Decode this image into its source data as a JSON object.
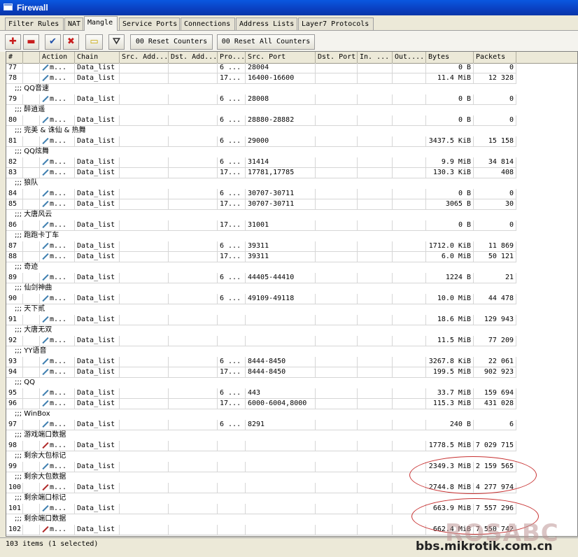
{
  "window": {
    "title": "Firewall"
  },
  "tabs": [
    "Filter Rules",
    "NAT",
    "Mangle",
    "Service Ports",
    "Connections",
    "Address Lists",
    "Layer7 Protocols"
  ],
  "active_tab": "Mangle",
  "toolbar": {
    "reset_counters": "00 Reset Counters",
    "reset_all_counters": "00 Reset All Counters"
  },
  "columns": [
    "#",
    "",
    "Action",
    "Chain",
    "Src. Add...",
    "Dst. Add...",
    "Pro...",
    "Src. Port",
    "Dst. Port",
    "In. ...",
    "Out....",
    "Bytes",
    "Packets"
  ],
  "rows": [
    {
      "type": "rule",
      "num": "77",
      "icon": "blue",
      "action": "m...",
      "chain": "Data_list",
      "proto": "6 ...",
      "src_port": "28004",
      "bytes": "0 B",
      "packets": "0"
    },
    {
      "type": "rule",
      "num": "78",
      "icon": "blue",
      "action": "m...",
      "chain": "Data_list",
      "proto": "17...",
      "src_port": "16400-16600",
      "bytes": "11.4 MiB",
      "packets": "12 328"
    },
    {
      "type": "comment",
      "text": ";;; QQ音速"
    },
    {
      "type": "rule",
      "num": "79",
      "icon": "blue",
      "action": "m...",
      "chain": "Data_list",
      "proto": "6 ...",
      "src_port": "28008",
      "bytes": "0 B",
      "packets": "0"
    },
    {
      "type": "comment",
      "text": ";;; 醉逍遥"
    },
    {
      "type": "rule",
      "num": "80",
      "icon": "blue",
      "action": "m...",
      "chain": "Data_list",
      "proto": "6 ...",
      "src_port": "28880-28882",
      "bytes": "0 B",
      "packets": "0"
    },
    {
      "type": "comment",
      "text": ";;; 完美 & 诛仙 & 热舞"
    },
    {
      "type": "rule",
      "num": "81",
      "icon": "blue",
      "action": "m...",
      "chain": "Data_list",
      "proto": "6 ...",
      "src_port": "29000",
      "bytes": "3437.5 KiB",
      "packets": "15 158"
    },
    {
      "type": "comment",
      "text": ";;; QQ炫舞"
    },
    {
      "type": "rule",
      "num": "82",
      "icon": "blue",
      "action": "m...",
      "chain": "Data_list",
      "proto": "6 ...",
      "src_port": "31414",
      "bytes": "9.9 MiB",
      "packets": "34 814"
    },
    {
      "type": "rule",
      "num": "83",
      "icon": "blue",
      "action": "m...",
      "chain": "Data_list",
      "proto": "17...",
      "src_port": "17781,17785",
      "bytes": "130.3 KiB",
      "packets": "408"
    },
    {
      "type": "comment",
      "text": ";;; 狼队"
    },
    {
      "type": "rule",
      "num": "84",
      "icon": "blue",
      "action": "m...",
      "chain": "Data_list",
      "proto": "6 ...",
      "src_port": "30707-30711",
      "bytes": "0 B",
      "packets": "0"
    },
    {
      "type": "rule",
      "num": "85",
      "icon": "blue",
      "action": "m...",
      "chain": "Data_list",
      "proto": "17...",
      "src_port": "30707-30711",
      "bytes": "3065 B",
      "packets": "30"
    },
    {
      "type": "comment",
      "text": ";;; 大唐风云"
    },
    {
      "type": "rule",
      "num": "86",
      "icon": "blue",
      "action": "m...",
      "chain": "Data_list",
      "proto": "17...",
      "src_port": "31001",
      "bytes": "0 B",
      "packets": "0"
    },
    {
      "type": "comment",
      "text": ";;; 跑跑卡丁车"
    },
    {
      "type": "rule",
      "num": "87",
      "icon": "blue",
      "action": "m...",
      "chain": "Data_list",
      "proto": "6 ...",
      "src_port": "39311",
      "bytes": "1712.0 KiB",
      "packets": "11 869"
    },
    {
      "type": "rule",
      "num": "88",
      "icon": "blue",
      "action": "m...",
      "chain": "Data_list",
      "proto": "17...",
      "src_port": "39311",
      "bytes": "6.0 MiB",
      "packets": "50 121"
    },
    {
      "type": "comment",
      "text": ";;; 奇迹"
    },
    {
      "type": "rule",
      "num": "89",
      "icon": "blue",
      "action": "m...",
      "chain": "Data_list",
      "proto": "6 ...",
      "src_port": "44405-44410",
      "bytes": "1224 B",
      "packets": "21"
    },
    {
      "type": "comment",
      "text": ";;; 仙剑神曲"
    },
    {
      "type": "rule",
      "num": "90",
      "icon": "blue",
      "action": "m...",
      "chain": "Data_list",
      "proto": "6 ...",
      "src_port": "49109-49118",
      "bytes": "10.0 MiB",
      "packets": "44 478"
    },
    {
      "type": "comment",
      "text": ";;; 天下贰"
    },
    {
      "type": "rule",
      "num": "91",
      "icon": "blue",
      "action": "m...",
      "chain": "Data_list",
      "proto": "",
      "src_port": "",
      "bytes": "18.6 MiB",
      "packets": "129 943"
    },
    {
      "type": "comment",
      "text": ";;; 大唐无双"
    },
    {
      "type": "rule",
      "num": "92",
      "icon": "blue",
      "action": "m...",
      "chain": "Data_list",
      "proto": "",
      "src_port": "",
      "bytes": "11.5 MiB",
      "packets": "77 209"
    },
    {
      "type": "comment",
      "text": ";;; YY语音"
    },
    {
      "type": "rule",
      "num": "93",
      "icon": "blue",
      "action": "m...",
      "chain": "Data_list",
      "proto": "6 ...",
      "src_port": "8444-8450",
      "bytes": "3267.8 KiB",
      "packets": "22 061"
    },
    {
      "type": "rule",
      "num": "94",
      "icon": "blue",
      "action": "m...",
      "chain": "Data_list",
      "proto": "17...",
      "src_port": "8444-8450",
      "bytes": "199.5 MiB",
      "packets": "902 923"
    },
    {
      "type": "comment",
      "text": ";;; QQ"
    },
    {
      "type": "rule",
      "num": "95",
      "icon": "blue",
      "action": "m...",
      "chain": "Data_list",
      "proto": "6 ...",
      "src_port": "443",
      "bytes": "33.7 MiB",
      "packets": "159 694"
    },
    {
      "type": "rule",
      "num": "96",
      "icon": "blue",
      "action": "m...",
      "chain": "Data_list",
      "proto": "17...",
      "src_port": "6000-6004,8000",
      "bytes": "115.3 MiB",
      "packets": "431 028"
    },
    {
      "type": "comment",
      "text": ";;; WinBox"
    },
    {
      "type": "rule",
      "num": "97",
      "icon": "blue",
      "action": "m...",
      "chain": "Data_list",
      "proto": "6 ...",
      "src_port": "8291",
      "bytes": "240 B",
      "packets": "6"
    },
    {
      "type": "comment",
      "text": ";;; 游戏端口数据"
    },
    {
      "type": "rule",
      "num": "98",
      "icon": "red",
      "action": "m...",
      "chain": "Data_list",
      "proto": "",
      "src_port": "",
      "bytes": "1778.5 MiB",
      "packets": "7 029 715"
    },
    {
      "type": "comment",
      "text": ";;; 剩余大包标记"
    },
    {
      "type": "rule",
      "num": "99",
      "icon": "blue",
      "action": "m...",
      "chain": "Data_list",
      "proto": "",
      "src_port": "",
      "bytes": "2349.3 MiB",
      "packets": "2 159 565"
    },
    {
      "type": "comment",
      "text": ";;; 剩余大包数据"
    },
    {
      "type": "rule",
      "num": "100",
      "icon": "red",
      "action": "m...",
      "chain": "Data_list",
      "proto": "",
      "src_port": "",
      "bytes": "2744.8 MiB",
      "packets": "4 277 974"
    },
    {
      "type": "comment",
      "text": ";;; 剩余端口标记"
    },
    {
      "type": "rule",
      "num": "101",
      "icon": "blue",
      "action": "m...",
      "chain": "Data_list",
      "proto": "",
      "src_port": "",
      "bytes": "663.9 MiB",
      "packets": "7 557 296"
    },
    {
      "type": "comment",
      "text": ";;; 剩余端口数据"
    },
    {
      "type": "rule",
      "num": "102",
      "icon": "red",
      "action": "m...",
      "chain": "Data_list",
      "proto": "",
      "src_port": "",
      "bytes": "662.4 MiB",
      "packets": "7 550 742"
    }
  ],
  "status": {
    "text": "103 items (1 selected)"
  },
  "watermark": {
    "big": "ROSABC",
    "small": "bbs.mikrotik.com.cn"
  }
}
